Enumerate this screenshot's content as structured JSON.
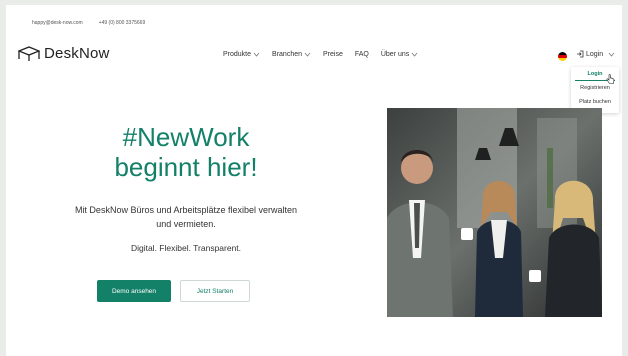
{
  "topbar": {
    "email": "happy@desk-now.com",
    "phone": "+49 (0) 800 3375669"
  },
  "header": {
    "brand": "DeskNow",
    "nav": [
      {
        "label": "Produkte",
        "has_dropdown": true
      },
      {
        "label": "Branchen",
        "has_dropdown": true
      },
      {
        "label": "Preise",
        "has_dropdown": false
      },
      {
        "label": "FAQ",
        "has_dropdown": false
      },
      {
        "label": "Über uns",
        "has_dropdown": true
      }
    ],
    "login_label": "Login"
  },
  "login_menu": {
    "items": [
      "Login",
      "Registrieren",
      "Platz buchen"
    ]
  },
  "hero": {
    "headline_line1": "#NewWork",
    "headline_line2": "beginnt hier!",
    "description_line1": "Mit DeskNow Büros und Arbeitsplätze flexibel verwalten",
    "description_line2": "und vermieten.",
    "tagline": "Digital. Flexibel. Transparent.",
    "primary_button": "Demo ansehen",
    "secondary_button": "Jetzt Starten"
  },
  "colors": {
    "brand": "#138068",
    "text": "#333333",
    "background": "#ffffff"
  },
  "icons": [
    "logo-desk-icon",
    "chevron-down-icon",
    "german-flag-icon",
    "login-arrow-icon",
    "hand-cursor-icon"
  ]
}
